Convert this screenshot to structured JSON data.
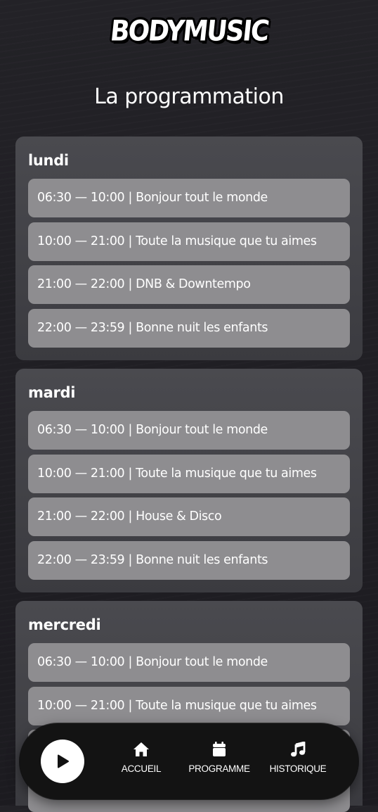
{
  "brand": {
    "logo_text": "BODYMUSIC"
  },
  "page_title": "La programmation",
  "days": [
    {
      "name": "lundi",
      "slots": [
        "06:30 — 10:00 | Bonjour tout le monde",
        "10:00 — 21:00 | Toute la musique que tu aimes",
        "21:00 — 22:00 | DNB & Downtempo",
        "22:00 — 23:59 | Bonne nuit les enfants"
      ]
    },
    {
      "name": "mardi",
      "slots": [
        "06:30 — 10:00 | Bonjour tout le monde",
        "10:00 — 21:00 | Toute la musique que tu aimes",
        "21:00 — 22:00 | House & Disco",
        "22:00 — 23:59 | Bonne nuit les enfants"
      ]
    },
    {
      "name": "mercredi",
      "slots": [
        "06:30 — 10:00 | Bonjour tout le monde",
        "10:00 — 21:00 | Toute la musique que tu aimes"
      ]
    }
  ],
  "player": {
    "play_icon": "play-icon",
    "nav": [
      {
        "label": "ACCUEIL",
        "icon": "home-icon"
      },
      {
        "label": "PROGRAMME",
        "icon": "calendar-icon"
      },
      {
        "label": "HISTORIQUE",
        "icon": "music-note-icon"
      }
    ]
  },
  "colors": {
    "background": "#1d1c21",
    "card": "#434348",
    "slot": "#8e8d90",
    "player_bar": "#131313",
    "text": "#ffffff"
  }
}
